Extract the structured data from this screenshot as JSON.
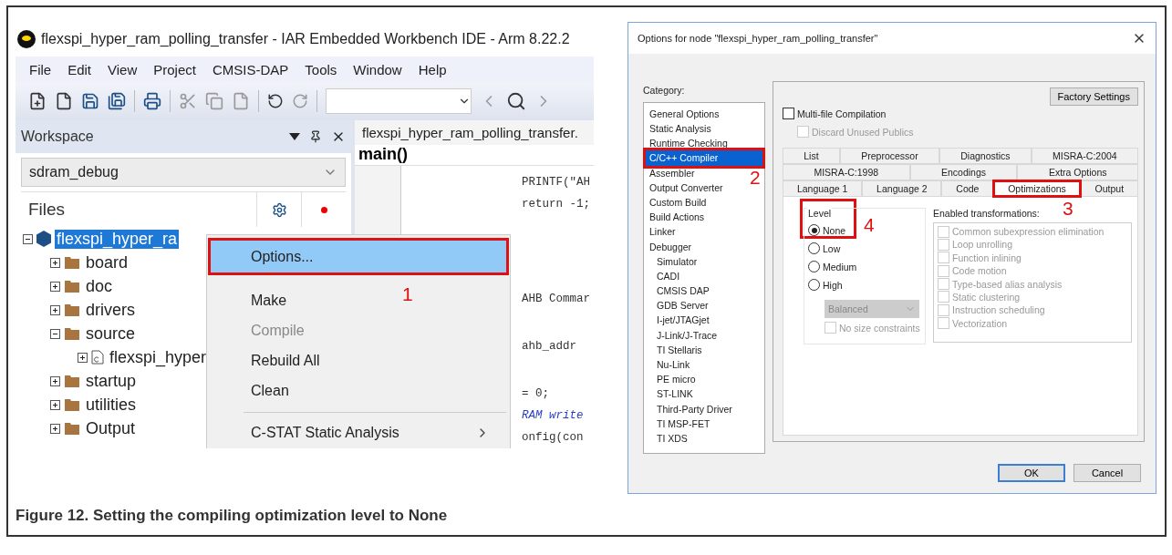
{
  "ide": {
    "title": "flexspi_hyper_ram_polling_transfer - IAR Embedded Workbench IDE - Arm 8.22.2",
    "menu": [
      "File",
      "Edit",
      "View",
      "Project",
      "CMSIS-DAP",
      "Tools",
      "Window",
      "Help"
    ],
    "workspace": {
      "title": "Workspace",
      "configuration": "sdram_debug",
      "files_header": "Files",
      "tree": [
        {
          "label": "flexspi_hyper_ra",
          "kind": "project",
          "selected": true,
          "expanded": true,
          "children": [
            {
              "label": "board",
              "kind": "folder",
              "selected": false,
              "expanded": false
            },
            {
              "label": "doc",
              "kind": "folder",
              "selected": false,
              "expanded": false
            },
            {
              "label": "drivers",
              "kind": "folder",
              "selected": false,
              "expanded": false
            },
            {
              "label": "source",
              "kind": "folder",
              "selected": false,
              "expanded": true,
              "children": [
                {
                  "label": "flexspi_hyper",
                  "kind": "file",
                  "selected": false,
                  "expanded": false
                }
              ]
            },
            {
              "label": "startup",
              "kind": "folder",
              "selected": false,
              "expanded": false
            },
            {
              "label": "utilities",
              "kind": "folder",
              "selected": false,
              "expanded": false
            },
            {
              "label": "Output",
              "kind": "folder",
              "selected": false,
              "expanded": false
            }
          ]
        }
      ]
    },
    "editor": {
      "tab": "flexspi_hyper_ram_polling_transfer.",
      "function": "main()",
      "code_lines": [
        {
          "text": "PRINTF(\"AH",
          "kind": "code"
        },
        {
          "text": "return -1;",
          "kind": "code"
        },
        {
          "text": "AHB Commar",
          "kind": "code"
        },
        {
          "text": "ahb_addr",
          "kind": "code"
        },
        {
          "text": "= 0;",
          "kind": "code"
        },
        {
          "text": "RAM write",
          "kind": "comment"
        },
        {
          "text": "onfig(con",
          "kind": "code"
        }
      ]
    },
    "context_menu": [
      {
        "label": "Options...",
        "selected": true,
        "disabled": false,
        "submenu": false,
        "callout": "1"
      },
      {
        "label": "Make",
        "selected": false,
        "disabled": false,
        "submenu": false
      },
      {
        "label": "Compile",
        "selected": false,
        "disabled": true,
        "submenu": false
      },
      {
        "label": "Rebuild All",
        "selected": false,
        "disabled": false,
        "submenu": false
      },
      {
        "label": "Clean",
        "selected": false,
        "disabled": false,
        "submenu": false,
        "separator_after": true
      },
      {
        "label": "C-STAT Static Analysis",
        "selected": false,
        "disabled": false,
        "submenu": true
      }
    ]
  },
  "dialog": {
    "title": "Options for node \"flexspi_hyper_ram_polling_transfer\"",
    "category_label": "Category:",
    "categories": [
      {
        "label": "General Options",
        "selected": false
      },
      {
        "label": "Static Analysis",
        "selected": false
      },
      {
        "label": "Runtime Checking",
        "selected": false
      },
      {
        "label": "C/C++ Compiler",
        "selected": true,
        "callout": "2"
      },
      {
        "label": "Assembler",
        "selected": false
      },
      {
        "label": "Output Converter",
        "selected": false
      },
      {
        "label": "Custom Build",
        "selected": false
      },
      {
        "label": "Build Actions",
        "selected": false
      },
      {
        "label": "Linker",
        "selected": false
      },
      {
        "label": "Debugger",
        "selected": false,
        "children": [
          {
            "label": "Simulator",
            "selected": false
          },
          {
            "label": "CADI",
            "selected": false
          },
          {
            "label": "CMSIS DAP",
            "selected": false
          },
          {
            "label": "GDB Server",
            "selected": false
          },
          {
            "label": "I-jet/JTAGjet",
            "selected": false
          },
          {
            "label": "J-Link/J-Trace",
            "selected": false
          },
          {
            "label": "TI Stellaris",
            "selected": false
          },
          {
            "label": "Nu-Link",
            "selected": false
          },
          {
            "label": "PE micro",
            "selected": false
          },
          {
            "label": "ST-LINK",
            "selected": false
          },
          {
            "label": "Third-Party Driver",
            "selected": false
          },
          {
            "label": "TI MSP-FET",
            "selected": false
          },
          {
            "label": "TI XDS",
            "selected": false
          }
        ]
      }
    ],
    "factory_settings": "Factory Settings",
    "multi_file": {
      "label": "Multi-file Compilation",
      "checked": false,
      "disabled": false
    },
    "discard": {
      "label": "Discard Unused Publics",
      "checked": false,
      "disabled": true
    },
    "tab_rows": [
      [
        {
          "label": "List",
          "selected": false
        },
        {
          "label": "Preprocessor",
          "selected": false
        },
        {
          "label": "Diagnostics",
          "selected": false
        },
        {
          "label": "MISRA-C:2004",
          "selected": false
        }
      ],
      [
        {
          "label": "MISRA-C:1998",
          "selected": false
        },
        {
          "label": "Encodings",
          "selected": false
        },
        {
          "label": "Extra Options",
          "selected": false
        }
      ],
      [
        {
          "label": "Language 1",
          "selected": false
        },
        {
          "label": "Language 2",
          "selected": false
        },
        {
          "label": "Code",
          "selected": false
        },
        {
          "label": "Optimizations",
          "selected": true,
          "callout": "3"
        },
        {
          "label": "Output",
          "selected": false
        }
      ]
    ],
    "level": {
      "label": "Level",
      "callout": "4",
      "options": [
        {
          "label": "None",
          "selected": true
        },
        {
          "label": "Low",
          "selected": false
        },
        {
          "label": "Medium",
          "selected": false
        },
        {
          "label": "High",
          "selected": false
        }
      ],
      "goal": {
        "value": "Balanced",
        "disabled": true
      },
      "no_size": {
        "label": "No size constraints",
        "checked": false,
        "disabled": true
      }
    },
    "transformations": {
      "label": "Enabled transformations:",
      "items": [
        {
          "label": "Common subexpression elimination",
          "checked": false,
          "disabled": true
        },
        {
          "label": "Loop unrolling",
          "checked": false,
          "disabled": true
        },
        {
          "label": "Function inlining",
          "checked": false,
          "disabled": true
        },
        {
          "label": "Code motion",
          "checked": false,
          "disabled": true
        },
        {
          "label": "Type-based alias analysis",
          "checked": false,
          "disabled": true
        },
        {
          "label": "Static clustering",
          "checked": false,
          "disabled": true
        },
        {
          "label": "Instruction scheduling",
          "checked": false,
          "disabled": true
        },
        {
          "label": "Vectorization",
          "checked": false,
          "disabled": true
        }
      ]
    },
    "buttons": [
      {
        "label": "OK",
        "default": true
      },
      {
        "label": "Cancel",
        "default": false
      }
    ]
  },
  "caption": "Figure 12.  Setting the compiling optimization level to None"
}
